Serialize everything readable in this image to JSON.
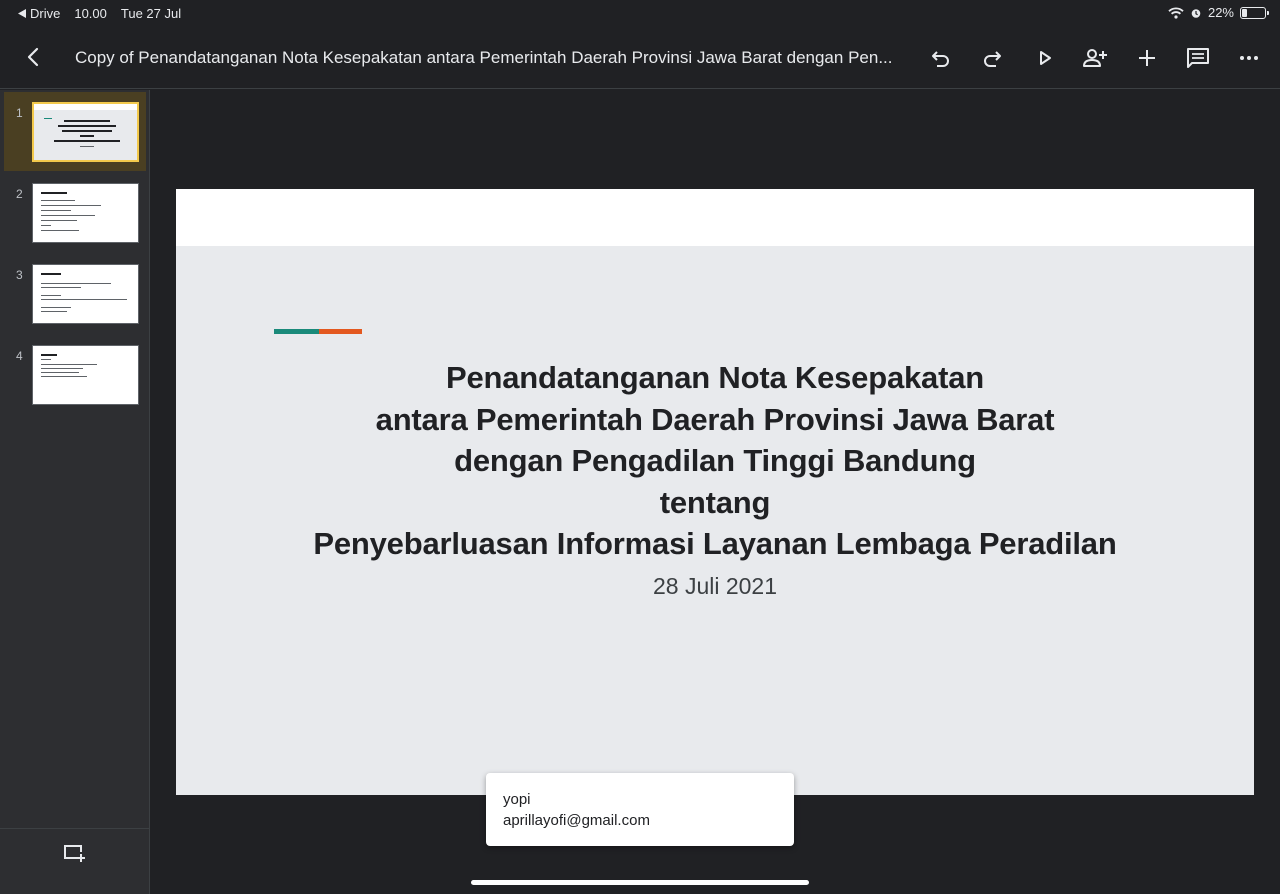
{
  "status_bar": {
    "back_app": "Drive",
    "time": "10.00",
    "date": "Tue 27 Jul",
    "battery": "22%",
    "battery_level": 0.22,
    "icons": [
      "wifi-icon",
      "alarm-icon",
      "battery-icon"
    ]
  },
  "toolbar": {
    "title": "Copy of Penandatanganan Nota Kesepakatan  antara Pemerintah Daerah Provinsi Jawa Barat  dengan Pen...",
    "icons": [
      "back-chevron-icon",
      "undo-icon",
      "redo-icon",
      "play-icon",
      "add-person-icon",
      "plus-icon",
      "comment-icon",
      "more-icon"
    ]
  },
  "sidebar": {
    "slides": [
      {
        "number": "1",
        "active": true
      },
      {
        "number": "2",
        "active": false
      },
      {
        "number": "3",
        "active": false
      },
      {
        "number": "4",
        "active": false
      }
    ],
    "footer_icon": "new-slide-icon"
  },
  "slide": {
    "title_lines": [
      "Penandatanganan Nota Kesepakatan",
      "antara Pemerintah Daerah Provinsi Jawa Barat",
      "dengan Pengadilan Tinggi Bandung",
      "tentang",
      "Penyebarluasan Informasi Layanan Lembaga Peradilan"
    ],
    "date": "28 Juli 2021",
    "accent_colors": [
      "#1a8a7a",
      "#e3581f"
    ]
  },
  "user_popup": {
    "name": "yopi",
    "email": "aprillayofi@gmail.com"
  }
}
